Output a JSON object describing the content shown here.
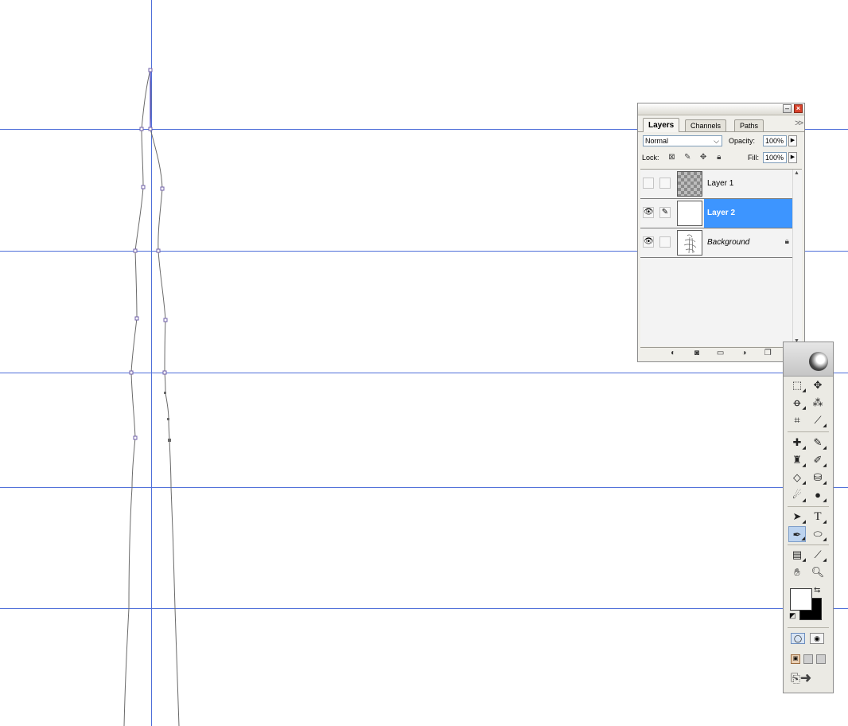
{
  "canvas": {
    "guide_color": "#4f6fd9",
    "path_color": "#6a6a6a"
  },
  "layers_palette": {
    "tabs": [
      {
        "label": "Layers",
        "active": true
      },
      {
        "label": "Channels",
        "active": false
      },
      {
        "label": "Paths",
        "active": false
      }
    ],
    "menu_icon": "double-chevron-right-icon",
    "blend_mode": "Normal",
    "opacity_label": "Opacity:",
    "opacity_value": "100%",
    "lock_label": "Lock:",
    "lock_icons": [
      "lock-transparent-icon",
      "lock-brush-icon",
      "lock-move-icon",
      "lock-all-icon"
    ],
    "fill_label": "Fill:",
    "fill_value": "100%",
    "layers": [
      {
        "name": "Layer 1",
        "visible": false,
        "linked": false,
        "thumbnail": "transparent-checker",
        "selected": false,
        "locked": false
      },
      {
        "name": "Layer 2",
        "visible": true,
        "linked": true,
        "thumbnail": "white",
        "selected": true,
        "locked": false
      },
      {
        "name": "Background",
        "visible": true,
        "linked": false,
        "thumbnail": "sketch",
        "selected": false,
        "locked": true
      }
    ],
    "footer_icons": [
      "layer-style-icon",
      "layer-mask-icon",
      "new-set-icon",
      "adjustment-layer-icon",
      "new-layer-icon",
      "trash-icon"
    ],
    "selection_color": "#3d95ff"
  },
  "toolbox": {
    "tools": [
      "marquee-icon",
      "move-icon",
      "lasso-icon",
      "magic-wand-icon",
      "crop-icon",
      "slice-icon",
      "healing-brush-icon",
      "brush-icon",
      "clone-stamp-icon",
      "history-brush-icon",
      "eraser-icon",
      "paint-bucket-icon",
      "blur-icon",
      "dodge-icon",
      "path-selection-icon",
      "type-icon",
      "pen-icon",
      "ellipse-shape-icon",
      "notes-icon",
      "eyedropper-icon",
      "hand-icon",
      "zoom-icon"
    ],
    "active_tool": "pen-icon",
    "foreground_color": "#ffffff",
    "background_color": "#000000"
  }
}
